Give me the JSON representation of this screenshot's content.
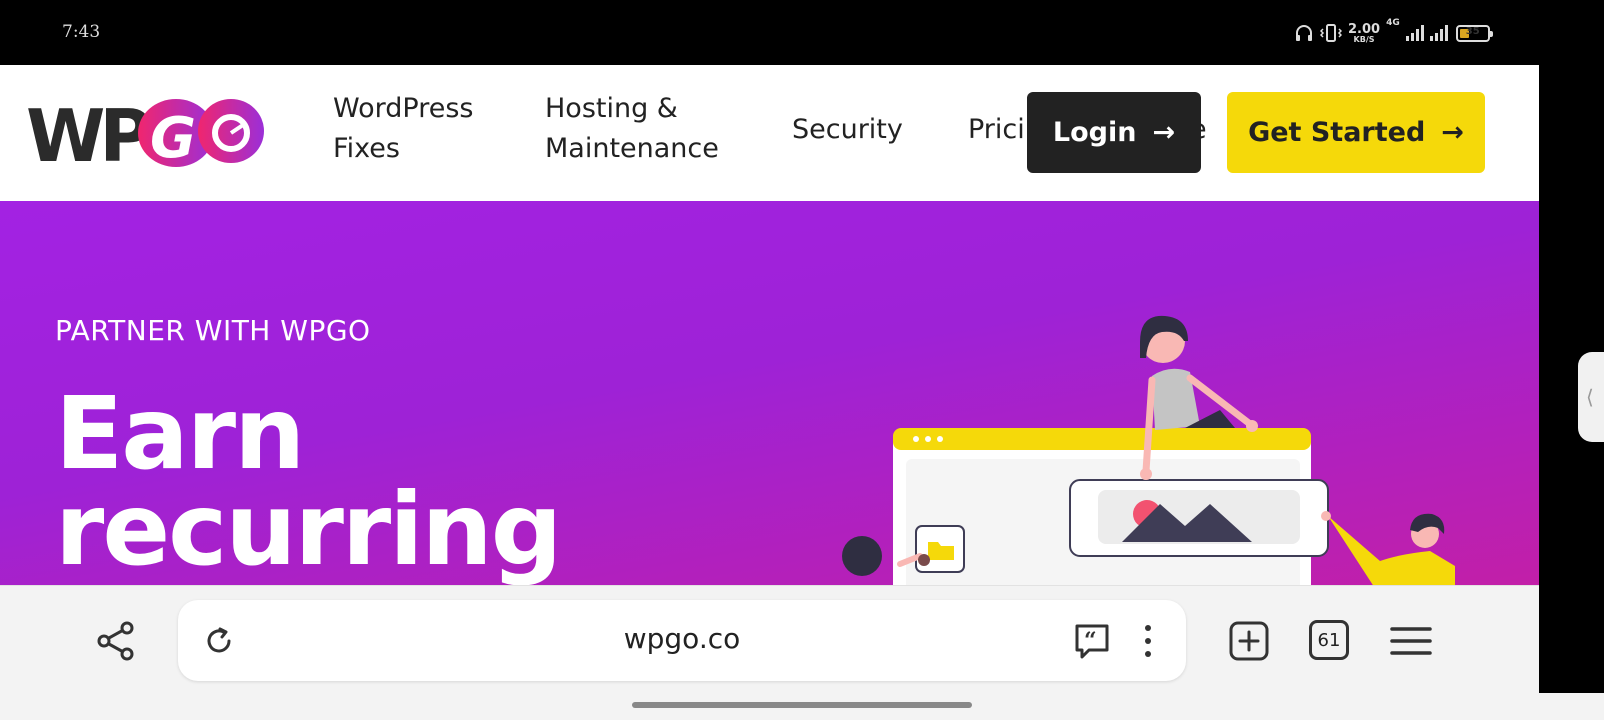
{
  "status_bar": {
    "time": "7:43",
    "speed_value": "2.00",
    "speed_unit": "KB/S",
    "network_type": "4G",
    "battery": "35"
  },
  "header": {
    "logo_text": "WPGO",
    "nav": [
      {
        "line1": "WordPress",
        "line2": "Fixes"
      },
      {
        "line1": "Hosting &",
        "line2": "Maintenance"
      },
      {
        "line1": "Security",
        "line2": ""
      },
      {
        "line1": "Prici",
        "line2": ""
      },
      {
        "line1": "e",
        "line2": ""
      }
    ],
    "login_label": "Login",
    "get_started_label": "Get Started",
    "arrow": "→",
    "accent_yellow": "#f5d90a",
    "dark": "#222222"
  },
  "hero": {
    "kicker": "PARTNER WITH WPGO",
    "title_line1": "Earn",
    "title_line2": "recurring",
    "gradient_start": "#a322e3",
    "gradient_end": "#c21fa8"
  },
  "browser": {
    "url": "wpgo.co",
    "tab_count": "61"
  },
  "side_handle": "⟨"
}
